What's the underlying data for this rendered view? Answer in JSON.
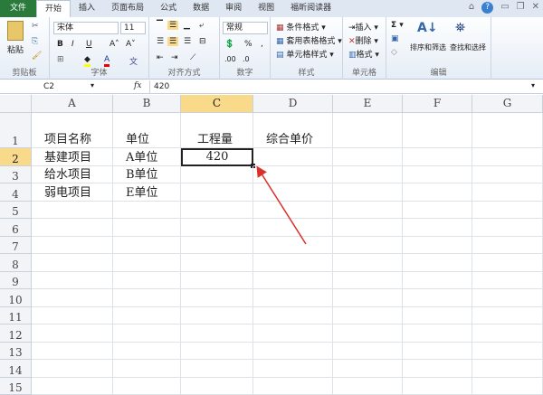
{
  "tabs": [
    "文件",
    "开始",
    "插入",
    "页面布局",
    "公式",
    "数据",
    "审阅",
    "视图",
    "福昕阅读器"
  ],
  "ribbon": {
    "clipboard": {
      "paste": "粘贴",
      "label": "剪贴板"
    },
    "font": {
      "name": "宋体",
      "size": "11",
      "bold": "B",
      "italic": "I",
      "underline": "U",
      "grow": "A˄",
      "shrink": "A˅",
      "label": "字体"
    },
    "align": {
      "label": "对齐方式"
    },
    "number": {
      "format": "常规",
      "percent": "%",
      "comma": ",",
      "label": "数字"
    },
    "styles": {
      "cond": "条件格式 ▾",
      "table": "套用表格格式 ▾",
      "cell": "单元格样式 ▾",
      "label": "样式"
    },
    "cells": {
      "insert": "插入 ▾",
      "delete": "删除 ▾",
      "format": "格式 ▾",
      "label": "单元格"
    },
    "editing": {
      "sum": "Σ ▾",
      "sort": "排序和筛选",
      "find": "查找和选择",
      "label": "编辑"
    }
  },
  "formula_bar": {
    "name_box": "C2",
    "fx": "fx",
    "value": "420"
  },
  "columns": [
    "A",
    "B",
    "C",
    "D",
    "E",
    "F",
    "G"
  ],
  "rows": [
    "1",
    "2",
    "3",
    "4",
    "5",
    "6",
    "7",
    "8",
    "9",
    "10",
    "11",
    "12",
    "13",
    "14",
    "15"
  ],
  "cells": {
    "A1": "项目名称",
    "B1": "单位",
    "C1": "工程量",
    "D1": "综合单价",
    "A2": "基建项目",
    "B2": "A单位",
    "C2": "420",
    "A3": "给水项目",
    "B3": "B单位",
    "A4": "弱电项目",
    "B4": "E单位"
  },
  "selected_cell": "C2",
  "colors": {
    "file_tab": "#2a7a3b",
    "selection": "#f9d98a",
    "arrow": "#d9302c"
  }
}
